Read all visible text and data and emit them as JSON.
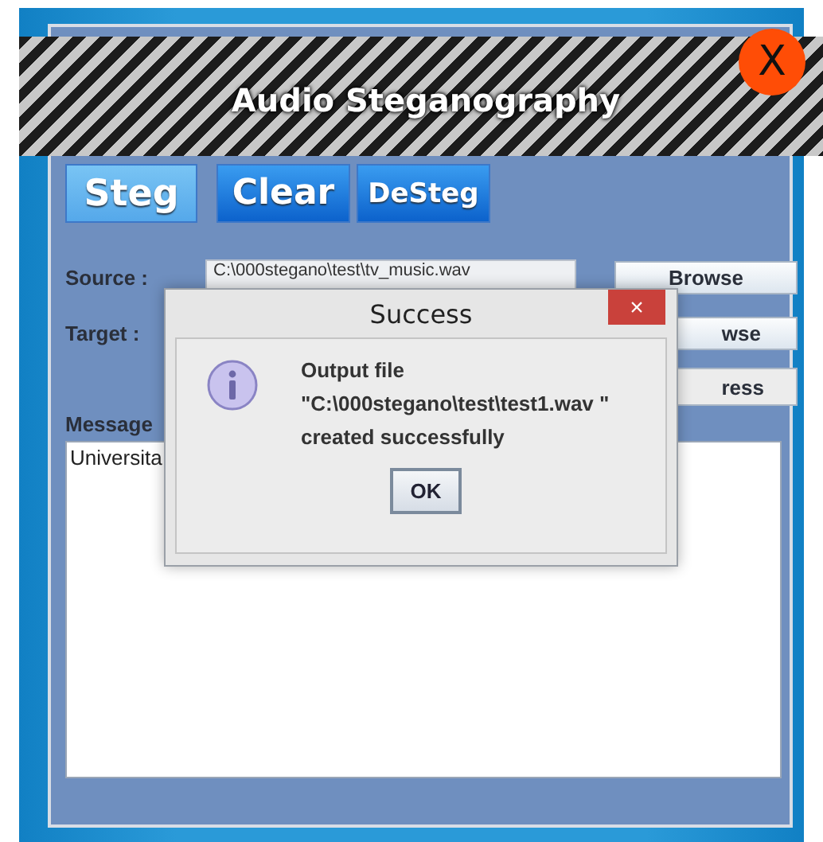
{
  "window": {
    "title": "Audio Steganography",
    "close_label": "X"
  },
  "toolbar": [
    {
      "label": "Steg",
      "highlighted": true
    },
    {
      "label": "Clear",
      "highlighted": false
    },
    {
      "label": "DeSteg",
      "highlighted": false
    }
  ],
  "form": {
    "source": {
      "label": "Source :",
      "value": "C:\\000stegano\\test\\tv_music.wav",
      "button": "Browse"
    },
    "target": {
      "label": "Target :",
      "button": "wse"
    },
    "action_button": "ress",
    "message": {
      "label": "Message",
      "value": "Universita"
    }
  },
  "dialog": {
    "title": "Success",
    "close_label": "×",
    "lines": [
      "Output file",
      "\"C:\\000stegano\\test\\test1.wav \"",
      "created successfully"
    ],
    "ok": "OK"
  }
}
